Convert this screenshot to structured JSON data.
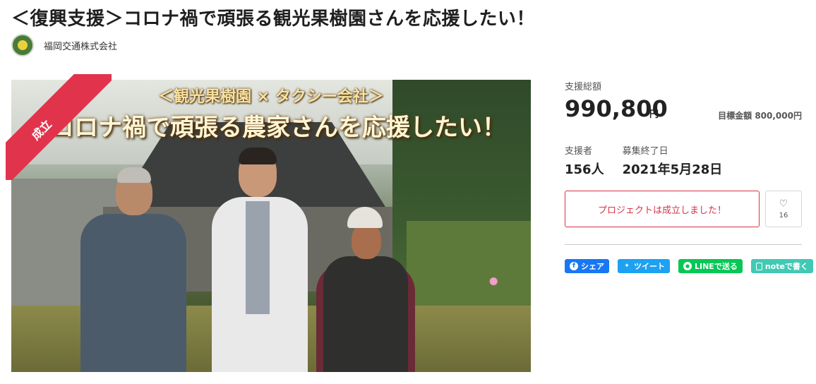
{
  "project": {
    "title": "＜復興支援＞コロナ禍で頑張る観光果樹園さんを応援したい！",
    "owner": "福岡交通株式会社"
  },
  "hero": {
    "badge": "成立",
    "overlay_line1": "＜観光果樹園 × タクシー会社＞",
    "overlay_line2": "コロナ禍で頑張る農家さんを応援したい！"
  },
  "funding": {
    "total_label": "支援総額",
    "total_value": "990,800",
    "total_unit": "円",
    "goal_label": "目標金額",
    "goal_value": "800,000円",
    "backers_label": "支援者",
    "backers_value": "156人",
    "end_label": "募集終了日",
    "end_value": "2021年5月28日"
  },
  "cta": {
    "status_label": "プロジェクトは成立しました！",
    "favorite_count": "16"
  },
  "share": {
    "facebook": "シェア",
    "twitter": "ツイート",
    "line": "LINEで送る",
    "note": "noteで書く"
  },
  "colors": {
    "accent_red": "#e2334d",
    "facebook": "#1877f2",
    "twitter": "#1da1f2",
    "line": "#06c755",
    "note": "#41c9b4"
  },
  "icons": [
    "heart-icon",
    "facebook-icon",
    "twitter-icon",
    "line-icon",
    "note-icon"
  ]
}
